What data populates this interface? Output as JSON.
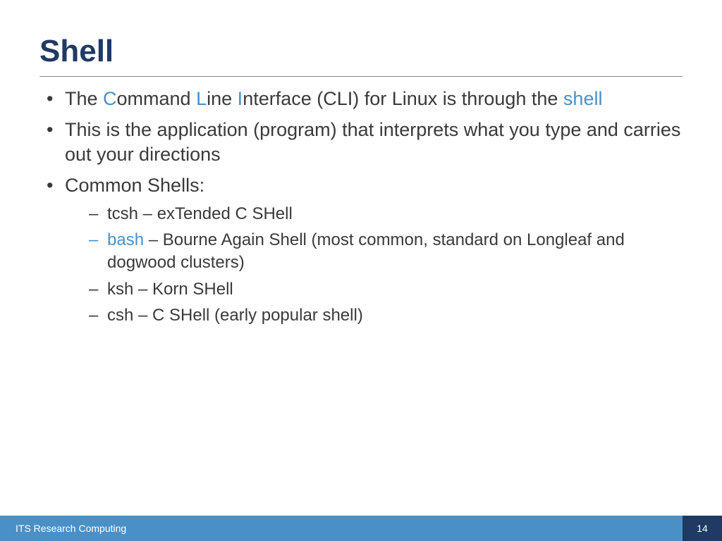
{
  "title": "Shell",
  "bullets": {
    "b1": {
      "pre": "The ",
      "c": "C",
      "ommand": "ommand ",
      "l": "L",
      "ine": "ine ",
      "i": "I",
      "rest": "nterface (CLI) for Linux is through the ",
      "shell": "shell"
    },
    "b2": "This is the application (program) that interprets what you type and carries out your directions",
    "b3": "Common Shells:"
  },
  "shells": {
    "tcsh": "tcsh – exTended C SHell",
    "bash_hl": "bash",
    "bash_rest": " – Bourne Again Shell (most common, standard on Longleaf and dogwood clusters)",
    "ksh": "ksh – Korn SHell",
    "csh": "csh – C SHell (early popular shell)"
  },
  "footer": {
    "left": "ITS Research Computing",
    "page": "14"
  }
}
